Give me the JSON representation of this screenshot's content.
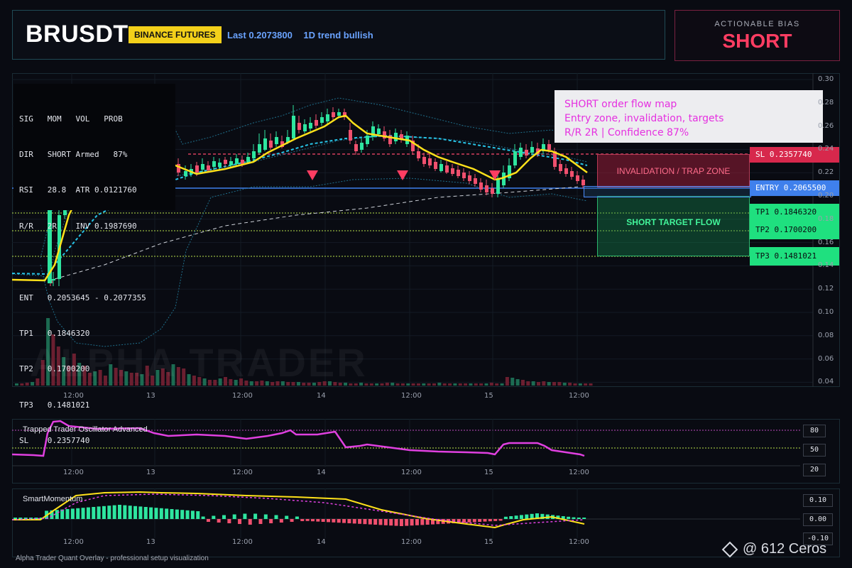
{
  "header": {
    "symbol": "BRUSDT",
    "exchange_badge": "BINANCE FUTURES",
    "last_price": "Last 0.2073800",
    "trend": "1D trend bullish"
  },
  "bias": {
    "label": "ACTIONABLE BIAS",
    "value": "SHORT",
    "color": "#ff3d62"
  },
  "info_box": {
    "rows": [
      "SIG   MOM   VOL   PROB",
      "DIR   SHORT Armed   87%",
      "RSI   28.8  ATR 0.0121760",
      "R/R   2R    INV 0.1987690",
      "",
      "ENT   0.2053645 - 0.2077355",
      "TP1   0.1846320",
      "TP2   0.1700200",
      "TP3   0.1481021",
      "SL    0.2357740"
    ]
  },
  "note": {
    "line1": "SHORT order flow map",
    "line2": "Entry zone, invalidation, targets",
    "line3": "R/R 2R | Confidence 87%"
  },
  "zones": {
    "invalidation": "INVALIDATION / TRAP ZONE",
    "target": "SHORT TARGET FLOW"
  },
  "tags": {
    "sl": "SL 0.2357740",
    "entry": "ENTRY 0.2065500",
    "tp1": "TP1 0.1846320",
    "tp2": "TP2 0.1700200",
    "tp3": "TP3 0.1481021"
  },
  "watermark": "ALPHA TRADER",
  "x_labels": [
    "12:00",
    "13",
    "12:00",
    "14",
    "12:00",
    "15",
    "12:00"
  ],
  "main_yaxis": [
    "0.30",
    "0.28",
    "0.26",
    "0.24",
    "0.22",
    "0.20",
    "0.18",
    "0.16",
    "0.14",
    "0.12",
    "0.10",
    "0.08",
    "0.06",
    "0.04"
  ],
  "oscillator": {
    "title": "Trapped Trader Oscillator Advanced",
    "levels": [
      "80",
      "50",
      "20"
    ],
    "color": "#e040e0"
  },
  "momentum": {
    "title": "SmartMomentum",
    "levels": [
      "0.10",
      "0.00",
      "-0.10"
    ]
  },
  "footer": "Alpha Trader Quant Overlay - professional setup visualization",
  "brand": "@ 612 Ceros",
  "colors": {
    "bull": "#2ee6a0",
    "bear": "#f0506e",
    "ema": "#ffe11a",
    "sl_line": "#ff4a6e",
    "entry_line": "#3f80ec",
    "tp_line": "#b8e04a"
  }
}
